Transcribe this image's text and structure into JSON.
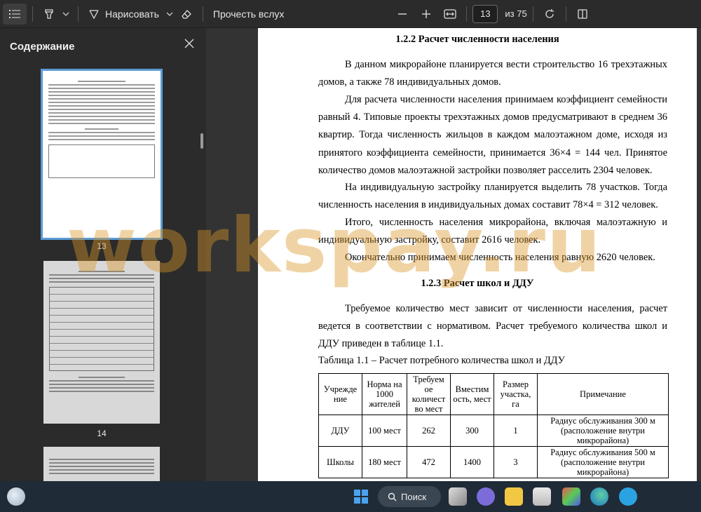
{
  "toolbar": {
    "draw_label": "Нарисовать",
    "read_aloud_label": "Прочесть вслух",
    "page_current": "13",
    "page_total": "из 75"
  },
  "sidebar": {
    "title": "Содержание",
    "thumbs": [
      {
        "label": "13"
      },
      {
        "label": "14"
      }
    ]
  },
  "document": {
    "heading1": "1.2.2 Расчет численности населения",
    "p1": "В данном микрорайоне планируется вести строительство 16 трехэтажных домов, а также 78 индивидуальных домов.",
    "p2": "Для расчета численности населения принимаем коэффициент семейности равный 4. Типовые проекты трехэтажных домов предусматривают в среднем 36 квартир. Тогда численность жильцов в каждом малоэтажном доме, исходя из принятого коэффициента семейности, принимается 36×4 = 144 чел. Принятое количество домов малоэтажной застройки позволяет расселить 2304 человек.",
    "p3": "На индивидуальную застройку планируется выделить 78 участков. Тогда численность населения в индивидуальных домах составит 78×4 = 312 человек.",
    "p4": "Итого, численность населения микрорайона, включая малоэтажную и индивидуальную застройку, составит 2616 человек.",
    "p5": "Окончательно принимаем численность населения равную 2620 человек.",
    "heading2": "1.2.3 Расчет школ и ДДУ",
    "p6": "Требуемое количество мест зависит от численности населения, расчет ведется в соответствии с нормативом. Расчет требуемого количества школ и ДДУ приведен в таблице 1.1.",
    "table_caption": "Таблица 1.1 – Расчет потребного количества школ и ДДУ",
    "table": {
      "headers": [
        "Учрежде ние",
        "Норма на 1000 жителей",
        "Требуем ое количест во мест",
        "Вместим ость, мест",
        "Размер участка, га",
        "Примечание"
      ],
      "rows": [
        [
          "ДДУ",
          "100 мест",
          "262",
          "300",
          "1",
          "Радиус обслуживания 300 м (расположение внутри микрорайона)"
        ],
        [
          "Школы",
          "180 мест",
          "472",
          "1400",
          "3",
          "Радиус обслуживания 500 м (расположение внутри микрорайона)"
        ]
      ]
    }
  },
  "watermark": "workspay.ru",
  "taskbar": {
    "search_label": "Поиск"
  },
  "colors": {
    "app_bg": "#2b2b2b",
    "taskbar_bg": "#1f2b36",
    "accent": "#4a90d9",
    "watermark": "#dc9628"
  }
}
